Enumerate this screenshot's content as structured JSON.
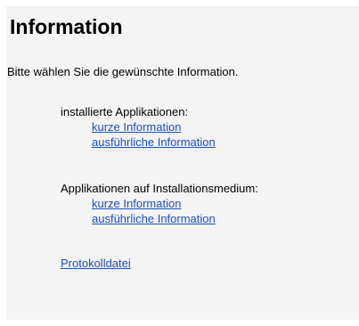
{
  "title": "Information",
  "intro": "Bitte wählen Sie die gewünschte Information.",
  "installed": {
    "label": "installierte Applikationen:",
    "short_link": "kurze Information",
    "detailed_link": "ausführliche Information"
  },
  "media": {
    "label": "Applikationen auf Installationsmedium:",
    "short_link": "kurze Information",
    "detailed_link": "ausführliche Information"
  },
  "log_link": "Protokolldatei",
  "colors": {
    "link": "#1a4fc7",
    "panel_background": "#f4f4f4"
  }
}
